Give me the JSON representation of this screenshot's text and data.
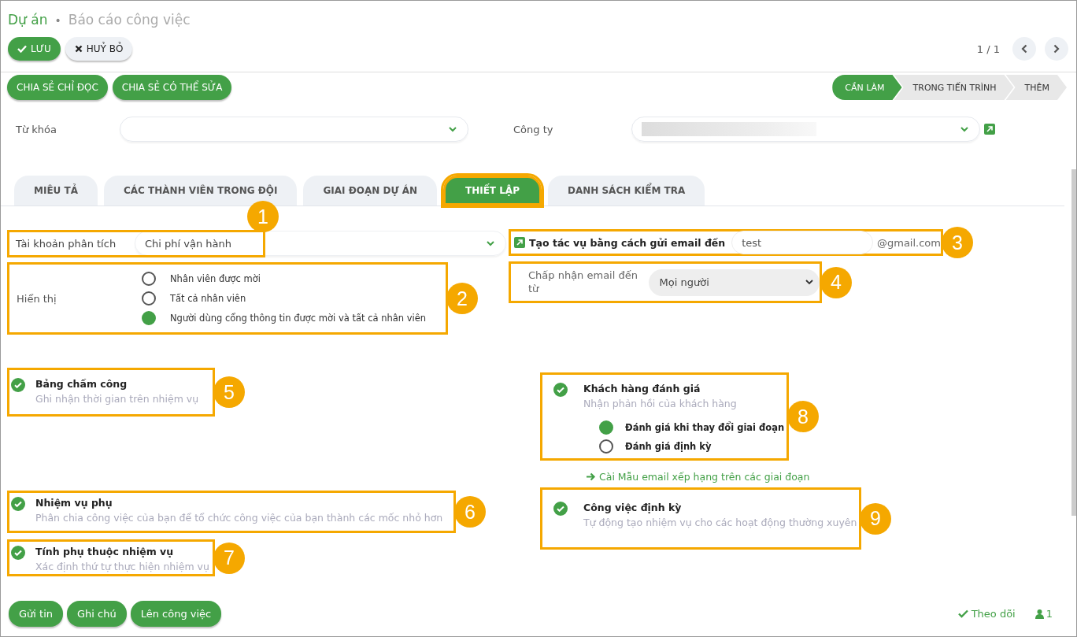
{
  "breadcrumb": {
    "parent": "Dự án",
    "separator": "•",
    "current": "Báo cáo công việc"
  },
  "actions": [
    {
      "label": "LƯU",
      "kind": "primary"
    },
    {
      "label": "HUỶ BỎ",
      "kind": "secondary"
    }
  ],
  "pager": {
    "text": "1 / 1"
  },
  "share_buttons": [
    "CHIA SẺ CHỈ ĐỌC",
    "CHIA SẺ CÓ THỂ SỬA"
  ],
  "stages": [
    {
      "label": "CẦN LÀM",
      "selected": true
    },
    {
      "label": "TRONG TIẾN TRÌNH",
      "selected": false
    },
    {
      "label": "THÊM",
      "selected": false
    }
  ],
  "fields": {
    "keyword": {
      "label": "Từ khóa"
    },
    "company": {
      "label": "Công ty"
    }
  },
  "tabs": [
    {
      "label": "MIÊU TẢ",
      "selected": false,
      "highlighted": false
    },
    {
      "label": "CÁC THÀNH VIÊN TRONG ĐỘI",
      "selected": false,
      "highlighted": false
    },
    {
      "label": "GIAI ĐOẠN DỰ ÁN",
      "selected": false,
      "highlighted": false
    },
    {
      "label": "THIẾT LẬP",
      "selected": true,
      "highlighted": true
    },
    {
      "label": "DANH SÁCH KIỂM TRA",
      "selected": false,
      "highlighted": false
    }
  ],
  "analytic_account": {
    "label": "Tài khoản phân tích",
    "value": "Chi phí vận hành",
    "callout": "1"
  },
  "visibility": {
    "label": "Hiển thị",
    "callout": "2",
    "options": [
      {
        "label": "Nhân viên được mời",
        "selected": false
      },
      {
        "label": "Tất cả nhân viên",
        "selected": false
      },
      {
        "label": "Người dùng cổng thông tin được mời và tất cả nhân viên",
        "selected": true
      }
    ]
  },
  "email_alias": {
    "label": "Tạo tác vụ bằng cách gửi email đến",
    "value": "test",
    "domain": "@gmail.com",
    "callout": "3"
  },
  "accept_from": {
    "label": "Chấp nhận email đến từ",
    "value": "Mọi người",
    "callout": "4"
  },
  "features_left": [
    {
      "title": "Bảng chấm công",
      "description": "Ghi nhận thời gian trên nhiệm vụ",
      "checked": true,
      "callout": "5"
    },
    {
      "title": "Nhiệm vụ phụ",
      "description": "Phân chia công việc của bạn để tổ chức công việc của bạn thành các mốc nhỏ hơn",
      "checked": true,
      "callout": "6"
    },
    {
      "title": "Tính phụ thuộc nhiệm vụ",
      "description": "Xác định thứ tự thực hiện nhiệm vụ",
      "checked": true,
      "callout": "7"
    }
  ],
  "rating": {
    "title": "Khách hàng đánh giá",
    "description": "Nhận phản hồi của khách hàng",
    "checked": true,
    "callout": "8",
    "options": [
      {
        "label": "Đánh giá khi thay đổi giai đoạn",
        "selected": true
      },
      {
        "label": "Đánh giá định kỳ",
        "selected": false
      }
    ]
  },
  "rating_link": "Cài Mẫu email xếp hạng trên các giai đoạn",
  "recurring": {
    "title": "Công việc định kỳ",
    "description": "Tự động tạo nhiệm vụ cho các hoạt động thường xuyên",
    "checked": true,
    "callout": "9"
  },
  "chatter": {
    "buttons": [
      "Gửi tin",
      "Ghi chú",
      "Lên công việc"
    ],
    "follow": "Theo dõi",
    "followers": "1"
  }
}
